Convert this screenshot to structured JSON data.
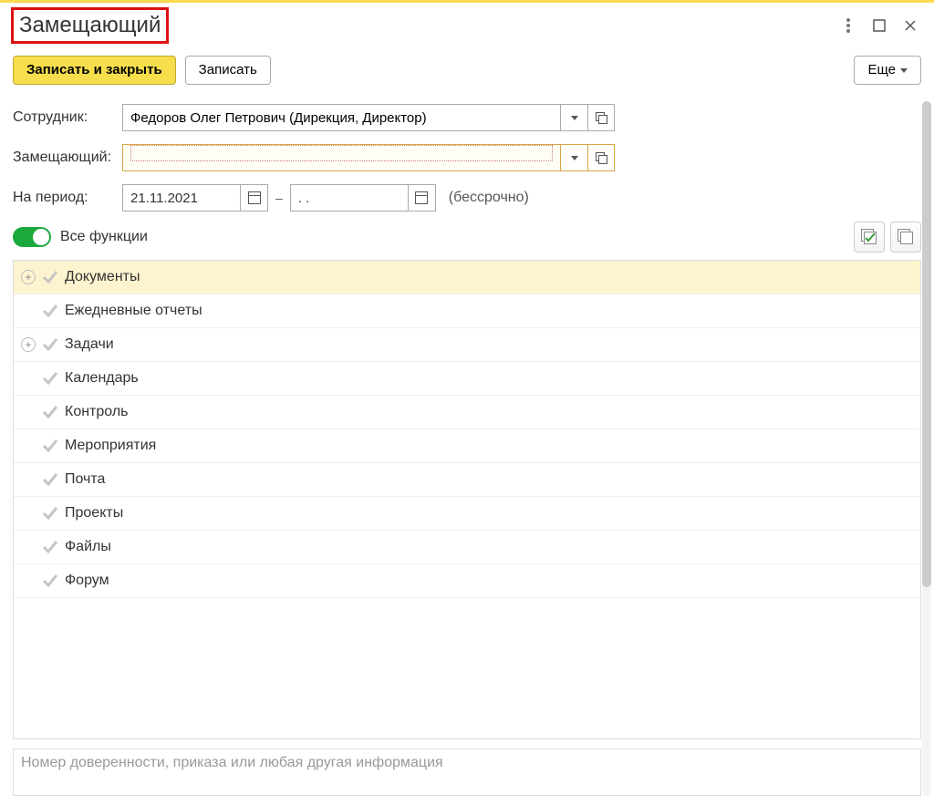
{
  "header": {
    "title": "Замещающий"
  },
  "toolbar": {
    "save_close": "Записать и закрыть",
    "save": "Записать",
    "more": "Еще"
  },
  "form": {
    "employee_label": "Сотрудник:",
    "employee_value": "Федоров Олег Петрович (Дирекция, Директор)",
    "substitute_label": "Замещающий:",
    "substitute_value": "",
    "period_label": "На период:",
    "date_from": "21.11.2021",
    "date_to": "  .  .    ",
    "period_hint": "(бессрочно)"
  },
  "functions": {
    "toggle_label": "Все функции",
    "toggle_on": true,
    "items": [
      {
        "label": "Документы",
        "expandable": true,
        "selected": true
      },
      {
        "label": "Ежедневные отчеты",
        "expandable": false,
        "selected": false
      },
      {
        "label": "Задачи",
        "expandable": true,
        "selected": false
      },
      {
        "label": "Календарь",
        "expandable": false,
        "selected": false
      },
      {
        "label": "Контроль",
        "expandable": false,
        "selected": false
      },
      {
        "label": "Мероприятия",
        "expandable": false,
        "selected": false
      },
      {
        "label": "Почта",
        "expandable": false,
        "selected": false
      },
      {
        "label": "Проекты",
        "expandable": false,
        "selected": false
      },
      {
        "label": "Файлы",
        "expandable": false,
        "selected": false
      },
      {
        "label": "Форум",
        "expandable": false,
        "selected": false
      }
    ]
  },
  "footer": {
    "note_placeholder": "Номер доверенности, приказа или любая другая информация"
  }
}
